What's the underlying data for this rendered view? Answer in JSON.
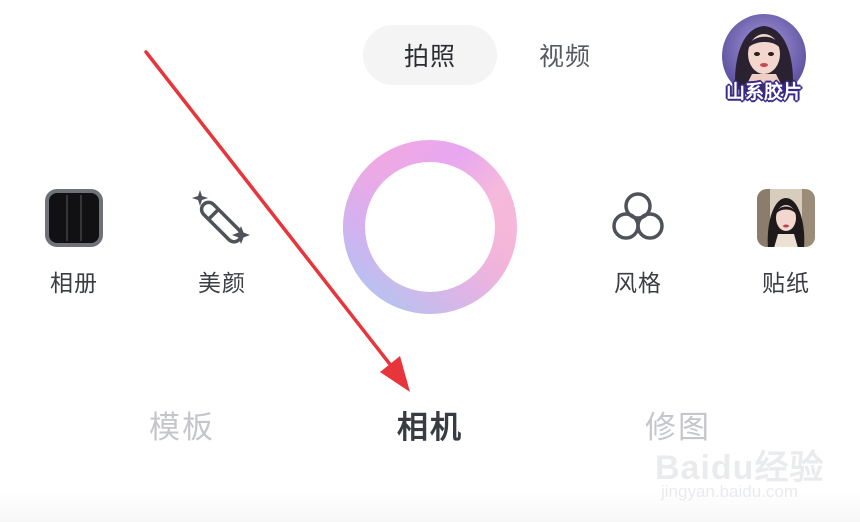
{
  "mode_switch": {
    "active": "拍照",
    "inactive": "视频"
  },
  "avatar_filter": {
    "caption": "山系胶片"
  },
  "tools": {
    "album": "相册",
    "beauty": "美颜",
    "style": "风格",
    "sticker": "贴纸"
  },
  "bottom_tabs": {
    "template": "模板",
    "camera": "相机",
    "retouch": "修图"
  },
  "watermark": {
    "brand": "Baidu经验",
    "url": "jingyan.baidu.com"
  },
  "colors": {
    "annotation_arrow": "#e8353b",
    "shutter_ring": [
      "#f7b0d6",
      "#e39bf0",
      "#b7b9f4",
      "#f6b4d8"
    ],
    "text_primary": "#383b41",
    "text_dim": "#c4c6cb"
  },
  "icons": {
    "album": "album-icon",
    "beauty": "magic-wand-icon",
    "style": "three-circles-icon",
    "sticker": "sticker-thumbnail-icon"
  }
}
